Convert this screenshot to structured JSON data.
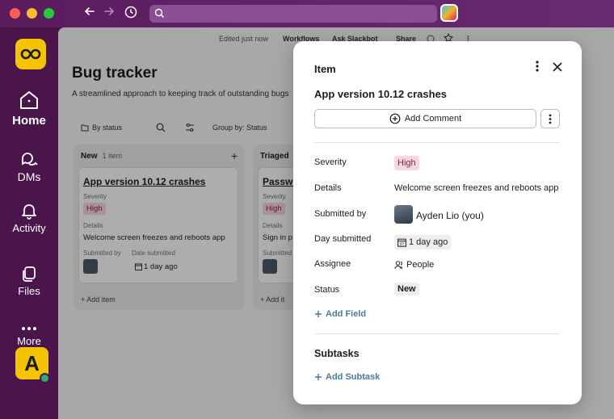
{
  "colors": {
    "aubergine": "#4a154b",
    "workspace": "#f5c400",
    "high_bg": "#f7d7df",
    "link": "#4b7a9c",
    "presence": "#2bac76"
  },
  "rail": {
    "items": [
      {
        "label": "Home",
        "icon": "home-icon"
      },
      {
        "label": "DMs",
        "icon": "dms-icon"
      },
      {
        "label": "Activity",
        "icon": "bell-icon"
      },
      {
        "label": "Files",
        "icon": "files-icon"
      },
      {
        "label": "More",
        "icon": "more-icon"
      }
    ],
    "user_initial": "A"
  },
  "toolbar": {
    "edited": "Edited just now",
    "workflows": "Workflows",
    "ask": "Ask Slackbot",
    "share": "Share"
  },
  "page": {
    "title": "Bug tracker",
    "description": "A streamlined approach to keeping track of outstanding bugs",
    "filter_status": "By status",
    "group_by": "Group by: Status"
  },
  "columns": [
    {
      "name": "New",
      "count": "1 item",
      "card": {
        "title": "App version 10.12 crashes",
        "severity_label": "Severity",
        "severity": "High",
        "details_label": "Details",
        "details": "Welcome screen freezes and reboots app",
        "submitted_label": "Submitted by",
        "date_label": "Date submitted",
        "date": "1 day ago"
      },
      "add_item": "+ Add item"
    },
    {
      "name": "Triaged",
      "card": {
        "title": "Passwo",
        "severity_label": "Severity",
        "severity": "High",
        "details_label": "Details",
        "details": "Sign in p",
        "submitted_label": "Submitted"
      },
      "add_item": "+ Add it"
    }
  ],
  "modal": {
    "header": "Item",
    "title": "App version 10.12 crashes",
    "add_comment": "Add Comment",
    "fields": {
      "severity_label": "Severity",
      "severity": "High",
      "details_label": "Details",
      "details": "Welcome screen freezes and reboots app",
      "submitted_label": "Submitted by",
      "submitted": "Ayden Lio (you)",
      "day_label": "Day submitted",
      "day": "1 day ago",
      "assignee_label": "Assignee",
      "assignee": "People",
      "status_label": "Status",
      "status": "New"
    },
    "add_field": "Add Field",
    "subtasks_header": "Subtasks",
    "add_subtask": "Add Subtask"
  }
}
